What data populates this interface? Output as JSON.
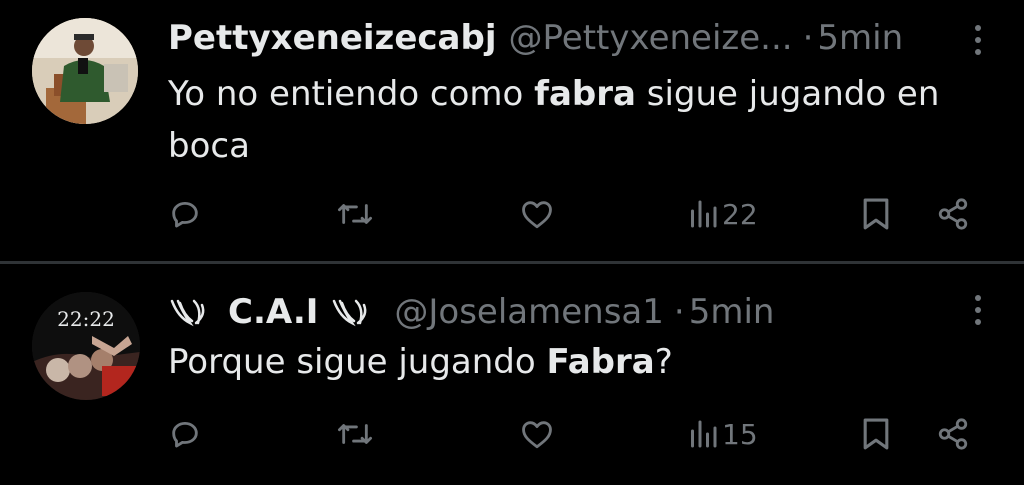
{
  "tweets": [
    {
      "name": "Pettyxeneizecabj",
      "handle": "@Pettyxeneize...",
      "separator": "·",
      "time": "5min",
      "text_parts": {
        "before": "Yo no entiendo como ",
        "bold": "fabra",
        "after": " sigue jugando en boca"
      },
      "views": "22",
      "icons": {
        "reply": "reply-icon",
        "retweet": "retweet-icon",
        "like": "like-icon",
        "views": "views-icon",
        "bookmark": "bookmark-icon",
        "share": "share-icon",
        "more": "more-icon"
      }
    },
    {
      "name": "C.A.I",
      "name_emojis": "wings-emoji",
      "handle": "@Joselamensa1",
      "separator": "·",
      "time": "5min",
      "avatar_text": "22:22",
      "text_parts": {
        "before": "Porque sigue jugando ",
        "bold": "Fabra",
        "after": "?"
      },
      "views": "15",
      "icons": {
        "reply": "reply-icon",
        "retweet": "retweet-icon",
        "like": "like-icon",
        "views": "views-icon",
        "bookmark": "bookmark-icon",
        "share": "share-icon",
        "more": "more-icon"
      }
    }
  ],
  "colors": {
    "background": "#000000",
    "text": "#e7e9ea",
    "muted": "#71767b",
    "divider": "#2f3336"
  }
}
